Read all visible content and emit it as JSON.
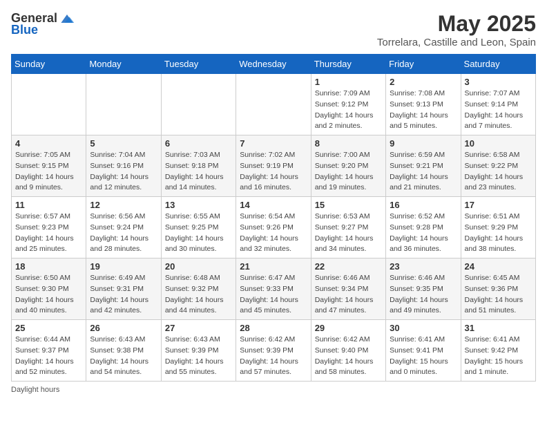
{
  "header": {
    "logo_general": "General",
    "logo_blue": "Blue",
    "month_title": "May 2025",
    "location": "Torrelara, Castille and Leon, Spain"
  },
  "columns": [
    "Sunday",
    "Monday",
    "Tuesday",
    "Wednesday",
    "Thursday",
    "Friday",
    "Saturday"
  ],
  "weeks": [
    [
      {
        "day": "",
        "detail": ""
      },
      {
        "day": "",
        "detail": ""
      },
      {
        "day": "",
        "detail": ""
      },
      {
        "day": "",
        "detail": ""
      },
      {
        "day": "1",
        "detail": "Sunrise: 7:09 AM\nSunset: 9:12 PM\nDaylight: 14 hours\nand 2 minutes."
      },
      {
        "day": "2",
        "detail": "Sunrise: 7:08 AM\nSunset: 9:13 PM\nDaylight: 14 hours\nand 5 minutes."
      },
      {
        "day": "3",
        "detail": "Sunrise: 7:07 AM\nSunset: 9:14 PM\nDaylight: 14 hours\nand 7 minutes."
      }
    ],
    [
      {
        "day": "4",
        "detail": "Sunrise: 7:05 AM\nSunset: 9:15 PM\nDaylight: 14 hours\nand 9 minutes."
      },
      {
        "day": "5",
        "detail": "Sunrise: 7:04 AM\nSunset: 9:16 PM\nDaylight: 14 hours\nand 12 minutes."
      },
      {
        "day": "6",
        "detail": "Sunrise: 7:03 AM\nSunset: 9:18 PM\nDaylight: 14 hours\nand 14 minutes."
      },
      {
        "day": "7",
        "detail": "Sunrise: 7:02 AM\nSunset: 9:19 PM\nDaylight: 14 hours\nand 16 minutes."
      },
      {
        "day": "8",
        "detail": "Sunrise: 7:00 AM\nSunset: 9:20 PM\nDaylight: 14 hours\nand 19 minutes."
      },
      {
        "day": "9",
        "detail": "Sunrise: 6:59 AM\nSunset: 9:21 PM\nDaylight: 14 hours\nand 21 minutes."
      },
      {
        "day": "10",
        "detail": "Sunrise: 6:58 AM\nSunset: 9:22 PM\nDaylight: 14 hours\nand 23 minutes."
      }
    ],
    [
      {
        "day": "11",
        "detail": "Sunrise: 6:57 AM\nSunset: 9:23 PM\nDaylight: 14 hours\nand 25 minutes."
      },
      {
        "day": "12",
        "detail": "Sunrise: 6:56 AM\nSunset: 9:24 PM\nDaylight: 14 hours\nand 28 minutes."
      },
      {
        "day": "13",
        "detail": "Sunrise: 6:55 AM\nSunset: 9:25 PM\nDaylight: 14 hours\nand 30 minutes."
      },
      {
        "day": "14",
        "detail": "Sunrise: 6:54 AM\nSunset: 9:26 PM\nDaylight: 14 hours\nand 32 minutes."
      },
      {
        "day": "15",
        "detail": "Sunrise: 6:53 AM\nSunset: 9:27 PM\nDaylight: 14 hours\nand 34 minutes."
      },
      {
        "day": "16",
        "detail": "Sunrise: 6:52 AM\nSunset: 9:28 PM\nDaylight: 14 hours\nand 36 minutes."
      },
      {
        "day": "17",
        "detail": "Sunrise: 6:51 AM\nSunset: 9:29 PM\nDaylight: 14 hours\nand 38 minutes."
      }
    ],
    [
      {
        "day": "18",
        "detail": "Sunrise: 6:50 AM\nSunset: 9:30 PM\nDaylight: 14 hours\nand 40 minutes."
      },
      {
        "day": "19",
        "detail": "Sunrise: 6:49 AM\nSunset: 9:31 PM\nDaylight: 14 hours\nand 42 minutes."
      },
      {
        "day": "20",
        "detail": "Sunrise: 6:48 AM\nSunset: 9:32 PM\nDaylight: 14 hours\nand 44 minutes."
      },
      {
        "day": "21",
        "detail": "Sunrise: 6:47 AM\nSunset: 9:33 PM\nDaylight: 14 hours\nand 45 minutes."
      },
      {
        "day": "22",
        "detail": "Sunrise: 6:46 AM\nSunset: 9:34 PM\nDaylight: 14 hours\nand 47 minutes."
      },
      {
        "day": "23",
        "detail": "Sunrise: 6:46 AM\nSunset: 9:35 PM\nDaylight: 14 hours\nand 49 minutes."
      },
      {
        "day": "24",
        "detail": "Sunrise: 6:45 AM\nSunset: 9:36 PM\nDaylight: 14 hours\nand 51 minutes."
      }
    ],
    [
      {
        "day": "25",
        "detail": "Sunrise: 6:44 AM\nSunset: 9:37 PM\nDaylight: 14 hours\nand 52 minutes."
      },
      {
        "day": "26",
        "detail": "Sunrise: 6:43 AM\nSunset: 9:38 PM\nDaylight: 14 hours\nand 54 minutes."
      },
      {
        "day": "27",
        "detail": "Sunrise: 6:43 AM\nSunset: 9:39 PM\nDaylight: 14 hours\nand 55 minutes."
      },
      {
        "day": "28",
        "detail": "Sunrise: 6:42 AM\nSunset: 9:39 PM\nDaylight: 14 hours\nand 57 minutes."
      },
      {
        "day": "29",
        "detail": "Sunrise: 6:42 AM\nSunset: 9:40 PM\nDaylight: 14 hours\nand 58 minutes."
      },
      {
        "day": "30",
        "detail": "Sunrise: 6:41 AM\nSunset: 9:41 PM\nDaylight: 15 hours\nand 0 minutes."
      },
      {
        "day": "31",
        "detail": "Sunrise: 6:41 AM\nSunset: 9:42 PM\nDaylight: 15 hours\nand 1 minute."
      }
    ]
  ],
  "footer": {
    "note": "Daylight hours"
  }
}
